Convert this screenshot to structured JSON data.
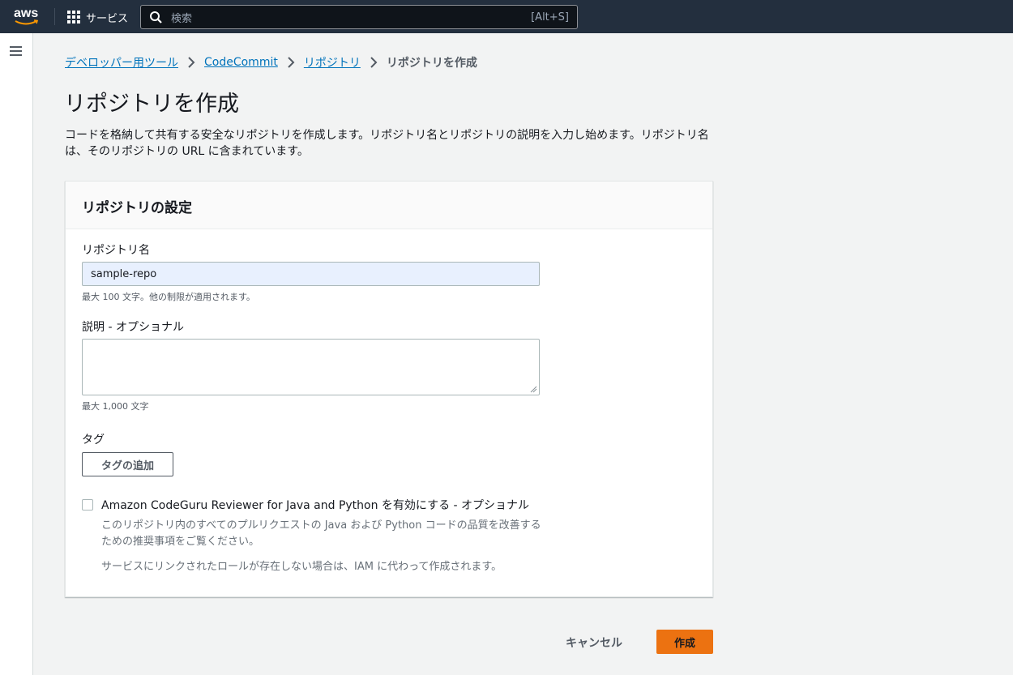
{
  "topnav": {
    "logo_text": "aws",
    "services_label": "サービス",
    "search_placeholder": "検索",
    "search_shortcut": "[Alt+S]"
  },
  "breadcrumb": {
    "items": [
      "デベロッパー用ツール",
      "CodeCommit",
      "リポジトリ"
    ],
    "current": "リポジトリを作成"
  },
  "page": {
    "title": "リポジトリを作成",
    "description": "コードを格納して共有する安全なリポジトリを作成します。リポジトリ名とリポジトリの説明を入力し始めます。リポジトリ名は、そのリポジトリの URL に含まれています。"
  },
  "settings": {
    "header": "リポジトリの設定",
    "name_label": "リポジトリ名",
    "name_value": "sample-repo",
    "name_hint": "最大 100 文字。他の制限が適用されます。",
    "desc_label": "説明 - オプショナル",
    "desc_value": "",
    "desc_hint": "最大 1,000 文字",
    "tags_label": "タグ",
    "add_tag_button": "タグの追加",
    "codeguru_label": "Amazon CodeGuru Reviewer for Java and Python を有効にする - オプショナル",
    "codeguru_desc": "このリポジトリ内のすべてのプルリクエストの Java および Python コードの品質を改善するための推奨事項をご覧ください。",
    "codeguru_note": "サービスにリンクされたロールが存在しない場合は、IAM に代わって作成されます。",
    "codeguru_checked": false
  },
  "actions": {
    "cancel_label": "キャンセル",
    "create_label": "作成"
  },
  "colors": {
    "nav_bg": "#232f3e",
    "link": "#0073bb",
    "primary_button": "#ec7211",
    "page_bg": "#f2f3f3"
  }
}
